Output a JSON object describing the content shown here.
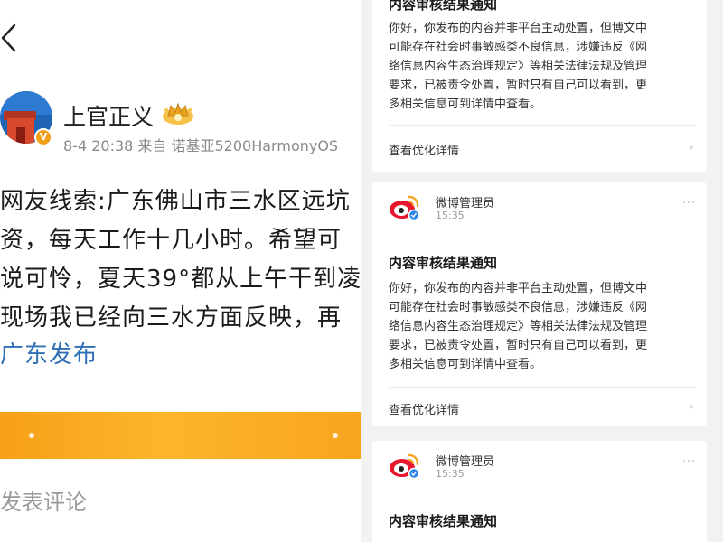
{
  "post": {
    "username": "上官正义",
    "verified_badge": "V",
    "meta": "8-4 20:38 来自 诺基亚5200HarmonyOS",
    "lines": [
      "网友线索:广东佛山市三水区远坑",
      "资，每天工作十几小时。希望可",
      "说可怜，夏天39°都从上午干到凌",
      "现场我已经向三水方面反映，再"
    ],
    "link_text": "广东发布",
    "comment_label": "发表评论",
    "icons": {
      "back": "chevron-left-icon",
      "crown": "crown-badge-icon"
    }
  },
  "notices": {
    "colors": {
      "weibo_red": "#e6162d",
      "weibo_yellow": "#f5a623",
      "verify_blue": "#2b86e8"
    },
    "cards": [
      {
        "sender": "",
        "time": "",
        "title": "内容审核结果通知",
        "body_lines": [
          "你好，你发布的内容并非平台主动处置，但博文中",
          "可能存在社会时事敏感类不良信息，涉嫌违反《网",
          "络信息内容生态治理规定》等相关法律法规及管理",
          "要求，已被责令处置，暂时只有自己可以看到，更",
          "多相关信息可到详情中查看。"
        ],
        "detail_link": "查看优化详情"
      },
      {
        "sender": "微博管理员",
        "time": "15:35",
        "title": "内容审核结果通知",
        "body_lines": [
          "你好，你发布的内容并非平台主动处置，但博文中",
          "可能存在社会时事敏感类不良信息，涉嫌违反《网",
          "络信息内容生态治理规定》等相关法律法规及管理",
          "要求，已被责令处置，暂时只有自己可以看到，更",
          "多相关信息可到详情中查看。"
        ],
        "detail_link": "查看优化详情"
      },
      {
        "sender": "微博管理员",
        "time": "15:35",
        "title": "内容审核结果通知"
      }
    ]
  }
}
